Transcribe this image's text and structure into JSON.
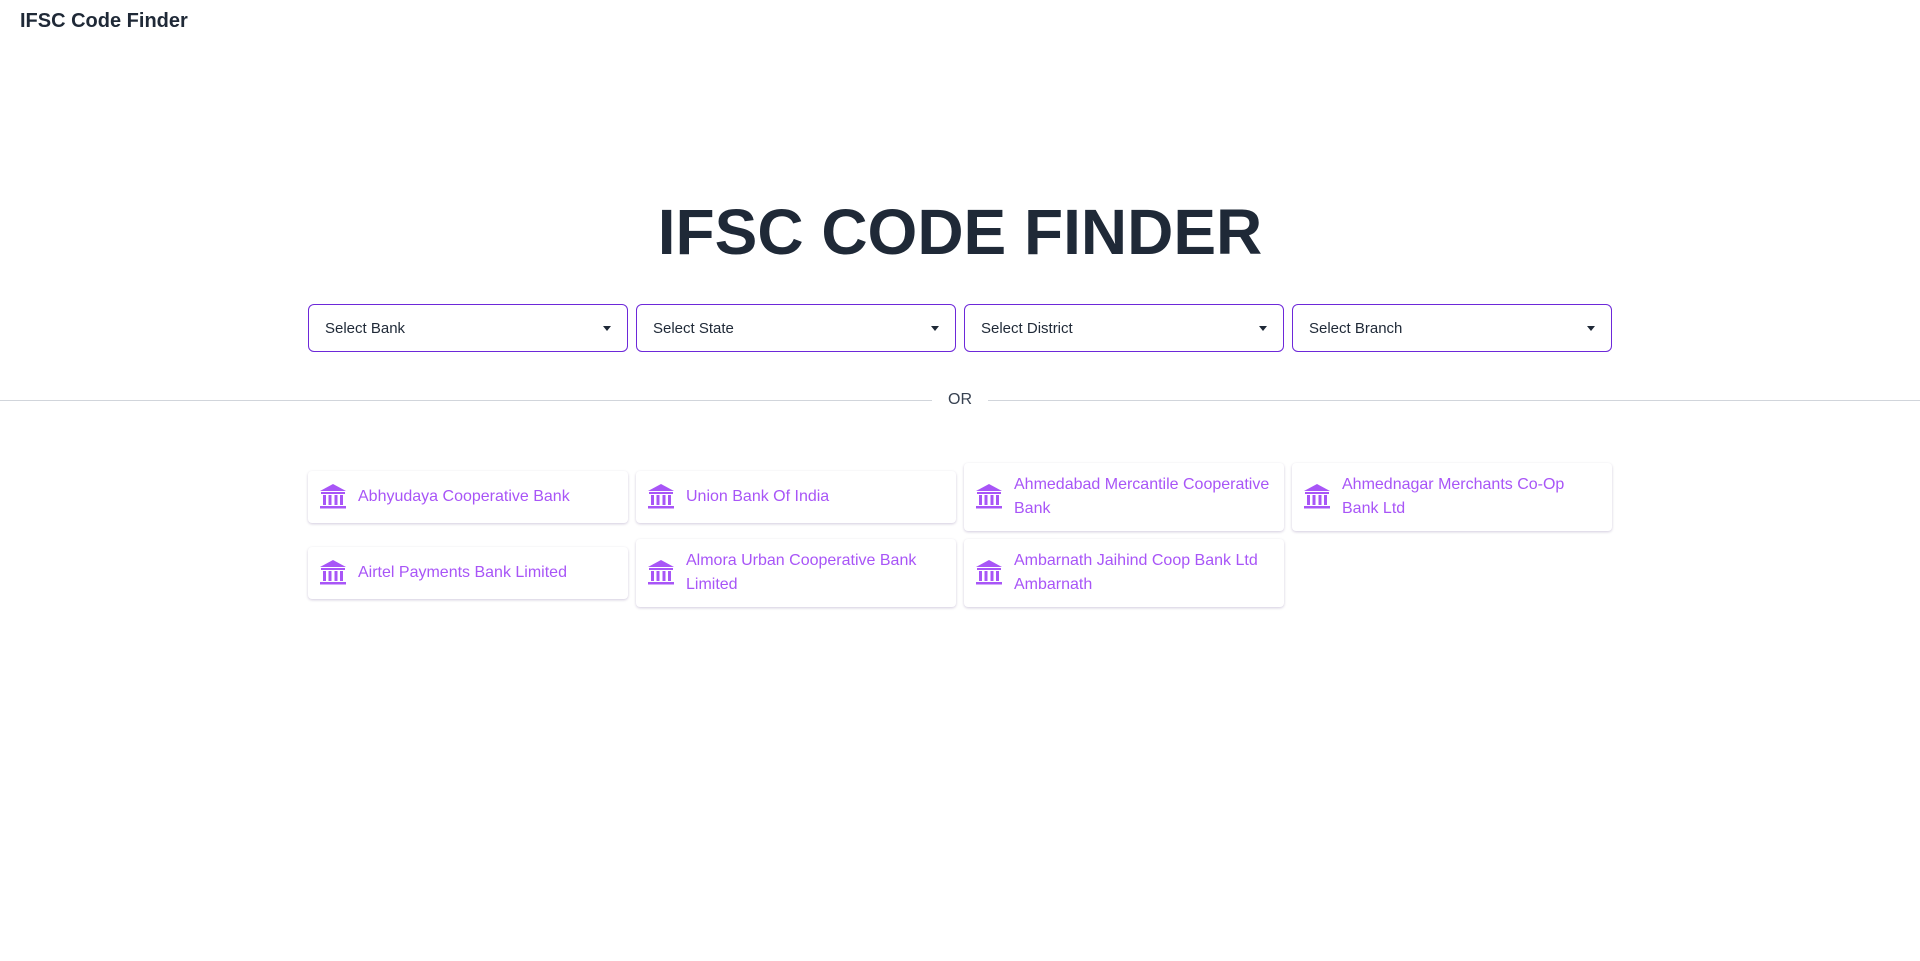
{
  "header": {
    "title": "IFSC Code Finder"
  },
  "hero": {
    "title": "IFSC CODE FINDER"
  },
  "filters": [
    {
      "label": "Select Bank"
    },
    {
      "label": "Select State"
    },
    {
      "label": "Select District"
    },
    {
      "label": "Select Branch"
    }
  ],
  "divider": {
    "label": "OR"
  },
  "banks": [
    {
      "name": "Abhyudaya Cooperative Bank",
      "icon": "bank-icon"
    },
    {
      "name": "Union Bank Of India",
      "icon": "bank-icon"
    },
    {
      "name": "Ahmedabad Mercantile Cooperative Bank",
      "icon": "bank-icon"
    },
    {
      "name": "Ahmednagar Merchants Co-Op Bank Ltd",
      "icon": "bank-icon"
    },
    {
      "name": "Airtel Payments Bank Limited",
      "icon": "bank-icon"
    },
    {
      "name": "Almora Urban Cooperative Bank Limited",
      "icon": "bank-icon"
    },
    {
      "name": "Ambarnath Jaihind Coop Bank Ltd Ambarnath",
      "icon": "bank-icon"
    }
  ],
  "colors": {
    "accent": "#6d28d9",
    "bank_text": "#a855f7",
    "heading": "#1f2937"
  }
}
